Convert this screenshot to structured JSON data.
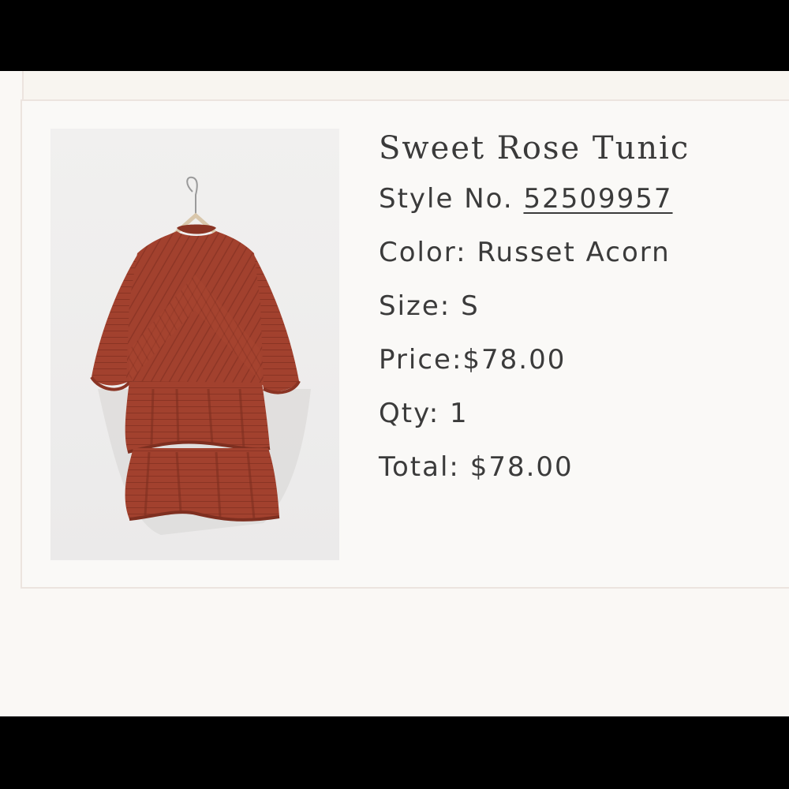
{
  "product": {
    "name": "Sweet Rose Tunic",
    "image_alt": "Sweet Rose Tunic",
    "style_label": "Style No.",
    "style_number": "52509957",
    "color_label": "Color:",
    "color_value": "Russet Acorn",
    "size_label": "Size:",
    "size_value": "S",
    "price_label": "Price:",
    "price_value": "$78.00",
    "qty_label": "Qty:",
    "qty_value": "1",
    "total_label": "Total:",
    "total_value": "$78.00"
  },
  "colors": {
    "garment": "#a2412e",
    "garment_shadow": "#7e2f20",
    "text": "#3b3b3b"
  },
  "icons": {
    "product_photo": "tunic-on-hanger-image"
  }
}
